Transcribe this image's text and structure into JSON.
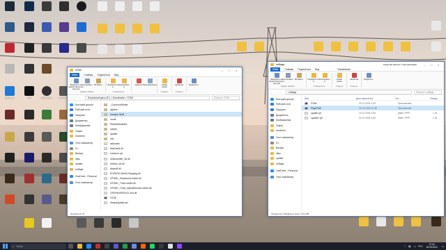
{
  "desktop": {
    "left_icons": [
      [
        "",
        "",
        "",
        "",
        ""
      ],
      [
        "",
        "",
        "",
        "",
        ""
      ],
      [
        "Battle.net",
        "MSI",
        "OBS Studio",
        "2_5997578...",
        ""
      ],
      [
        "",
        "",
        "",
        "",
        ""
      ]
    ],
    "left_labels": [
      "Battle.net",
      "MSI",
      "OBS Studio",
      "2_5997578..."
    ]
  },
  "left_window": {
    "title": "GTAV",
    "tabs": [
      "Файл",
      "Главная",
      "Поделиться",
      "Вид"
    ],
    "ribbon": {
      "groups": [
        {
          "label": "Буфер обмена",
          "buttons": [
            "Закрепить на панели быстрого доступа",
            "Копировать",
            "Вставить"
          ]
        },
        {
          "label": "Упорядочить",
          "buttons": [
            "Переместить в",
            "Копировать в"
          ]
        },
        {
          "label": "",
          "buttons": [
            "Удалить",
            "Переименовать"
          ]
        },
        {
          "label": "Создать",
          "buttons": [
            "Новая папка"
          ]
        },
        {
          "label": "Открыть",
          "buttons": [
            "Свойства"
          ]
        },
        {
          "label": "",
          "buttons": [
            "Выделить"
          ]
        }
      ]
    },
    "address": [
      "Локальный диск (E:)",
      "Downloads",
      "GTAV"
    ],
    "search_placeholder": "Поиск в: GTAV",
    "nav": [
      {
        "label": "Быстрый доступ",
        "color": "#1e90ff"
      },
      {
        "label": "Рабочий стол",
        "color": "#3a7bd5"
      },
      {
        "label": "Загрузки",
        "color": "#3a7bd5"
      },
      {
        "label": "Документы",
        "color": "#6b7b8c"
      },
      {
        "label": "Изображения",
        "color": "#6b7b8c"
      },
      {
        "label": "Output",
        "color": "#e8b84a"
      },
      {
        "label": "rendered",
        "color": "#e8b84a"
      },
      {
        "label": "Этот компьютер",
        "color": "#4a90d9"
      },
      {
        "label": "D:\\",
        "color": "#8c8c8c"
      },
      {
        "label": "Backup",
        "color": "#e8b84a"
      },
      {
        "label": "clips",
        "color": "#e8b84a"
      },
      {
        "label": "update",
        "color": "#e8b84a"
      },
      {
        "label": "победа",
        "color": "#e8b84a"
      },
      {
        "label": "OneDrive - Personal",
        "color": "#1e90ff"
      },
      {
        "label": "Этот компьютер",
        "color": "#4a90d9"
      }
    ],
    "files": [
      {
        "name": "_CommonRedist",
        "color": "#e8b84a",
        "selected": false
      },
      {
        "name": "agnitve",
        "color": "#e8b84a",
        "selected": false
      },
      {
        "name": "menyoo Stuff",
        "color": "#e8b84a",
        "selected": true
      },
      {
        "name": "mods",
        "color": "#e8b84a",
        "selected": false
      },
      {
        "name": "Redistributables",
        "color": "#e8b84a",
        "selected": false
      },
      {
        "name": "scripts",
        "color": "#e8b84a",
        "selected": false
      },
      {
        "name": "update",
        "color": "#e8b84a",
        "selected": false
      },
      {
        "name": "x64",
        "color": "#e8b84a",
        "selected": false
      },
      {
        "name": "asiloader",
        "color": "#e8e8e8",
        "selected": false
      },
      {
        "name": "bink2w64.dll",
        "color": "#e8e8e8",
        "selected": false
      },
      {
        "name": "common.rpf",
        "color": "#e8e8e8",
        "selected": false
      },
      {
        "name": "d3dcompiler_46.dll",
        "color": "#e8e8e8",
        "selected": false
      },
      {
        "name": "d3dcsx_46.dll",
        "color": "#e8e8e8",
        "selected": false
      },
      {
        "name": "dinput8.dll",
        "color": "#e8e8e8",
        "selected": false
      },
      {
        "name": "EOSSDK-Win64-Shipping.dll",
        "color": "#e8e8e8",
        "selected": false
      },
      {
        "name": "GFSDK_ShadowLib.win64.dll",
        "color": "#e8e8e8",
        "selected": false
      },
      {
        "name": "GFSDK_TXAA.win64.dll",
        "color": "#e8e8e8",
        "selected": false
      },
      {
        "name": "GFSDK_TXAA_AlphaResolve.win64.dll",
        "color": "#e8e8e8",
        "selected": false
      },
      {
        "name": "GPUPerfAPIDX11-x64.dll",
        "color": "#e8e8e8",
        "selected": false
      },
      {
        "name": "GTA5",
        "color": "#3a4a8c",
        "selected": false
      },
      {
        "name": "HeapAdjuster.asi",
        "color": "#e8e8e8",
        "selected": false
      }
    ],
    "status": "Элементов: 87"
  },
  "right_window": {
    "title": "победа",
    "tabs": [
      "Файл",
      "Главная",
      "Поделиться",
      "Вид"
    ],
    "context_tab_group": "Средства работы с приложениями",
    "context_tab": "Управление",
    "address": [
      "победа"
    ],
    "search_placeholder": "Поиск в: победа",
    "columns": [
      "Имя",
      "Дата изменения",
      "Тип",
      "Размер"
    ],
    "files": [
      {
        "name": "GTA5",
        "date": "22.07.2024 2:09",
        "type": "Приложение",
        "size": "",
        "color": "#3a4a8c",
        "selected": false
      },
      {
        "name": "PlayGTAV",
        "date": "01.07.2024 21:48",
        "type": "Приложение",
        "size": "",
        "color": "#3a4a8c",
        "selected": true
      },
      {
        "name": "update.rpf",
        "date": "22.07.2024 2:09",
        "type": "Файл \"RPF\"",
        "size": "1 91",
        "color": "#e8e8e8",
        "selected": false
      },
      {
        "name": "update2.rpf",
        "date": "22.07.2024 2:40",
        "type": "Файл \"RPF\"",
        "size": "1 51",
        "color": "#e8e8e8",
        "selected": false
      }
    ],
    "nav": [
      {
        "label": "Быстрый доступ",
        "color": "#1e90ff"
      },
      {
        "label": "Рабочий стол",
        "color": "#3a7bd5"
      },
      {
        "label": "Загрузки",
        "color": "#3a7bd5"
      },
      {
        "label": "Документы",
        "color": "#6b7b8c"
      },
      {
        "label": "Изображения",
        "color": "#6b7b8c"
      },
      {
        "label": "Output",
        "color": "#e8b84a"
      },
      {
        "label": "rendered",
        "color": "#e8b84a"
      },
      {
        "label": "Этот компьютер",
        "color": "#4a90d9"
      },
      {
        "label": "D:\\",
        "color": "#8c8c8c"
      },
      {
        "label": "Backup",
        "color": "#e8b84a"
      },
      {
        "label": "clips",
        "color": "#e8b84a"
      },
      {
        "label": "update",
        "color": "#e8b84a"
      },
      {
        "label": "победа",
        "color": "#e8b84a"
      },
      {
        "label": "OneDrive - Personal",
        "color": "#1e90ff"
      },
      {
        "label": "Этот компьютер",
        "color": "#4a90d9"
      }
    ],
    "status": "Элементов: 4    Выбран 2 элем.: 53,4 МБ"
  },
  "taskbar": {
    "search_placeholder": "Поиск",
    "time": "17:42",
    "date": "18.09.2024",
    "lang": "РУС"
  }
}
